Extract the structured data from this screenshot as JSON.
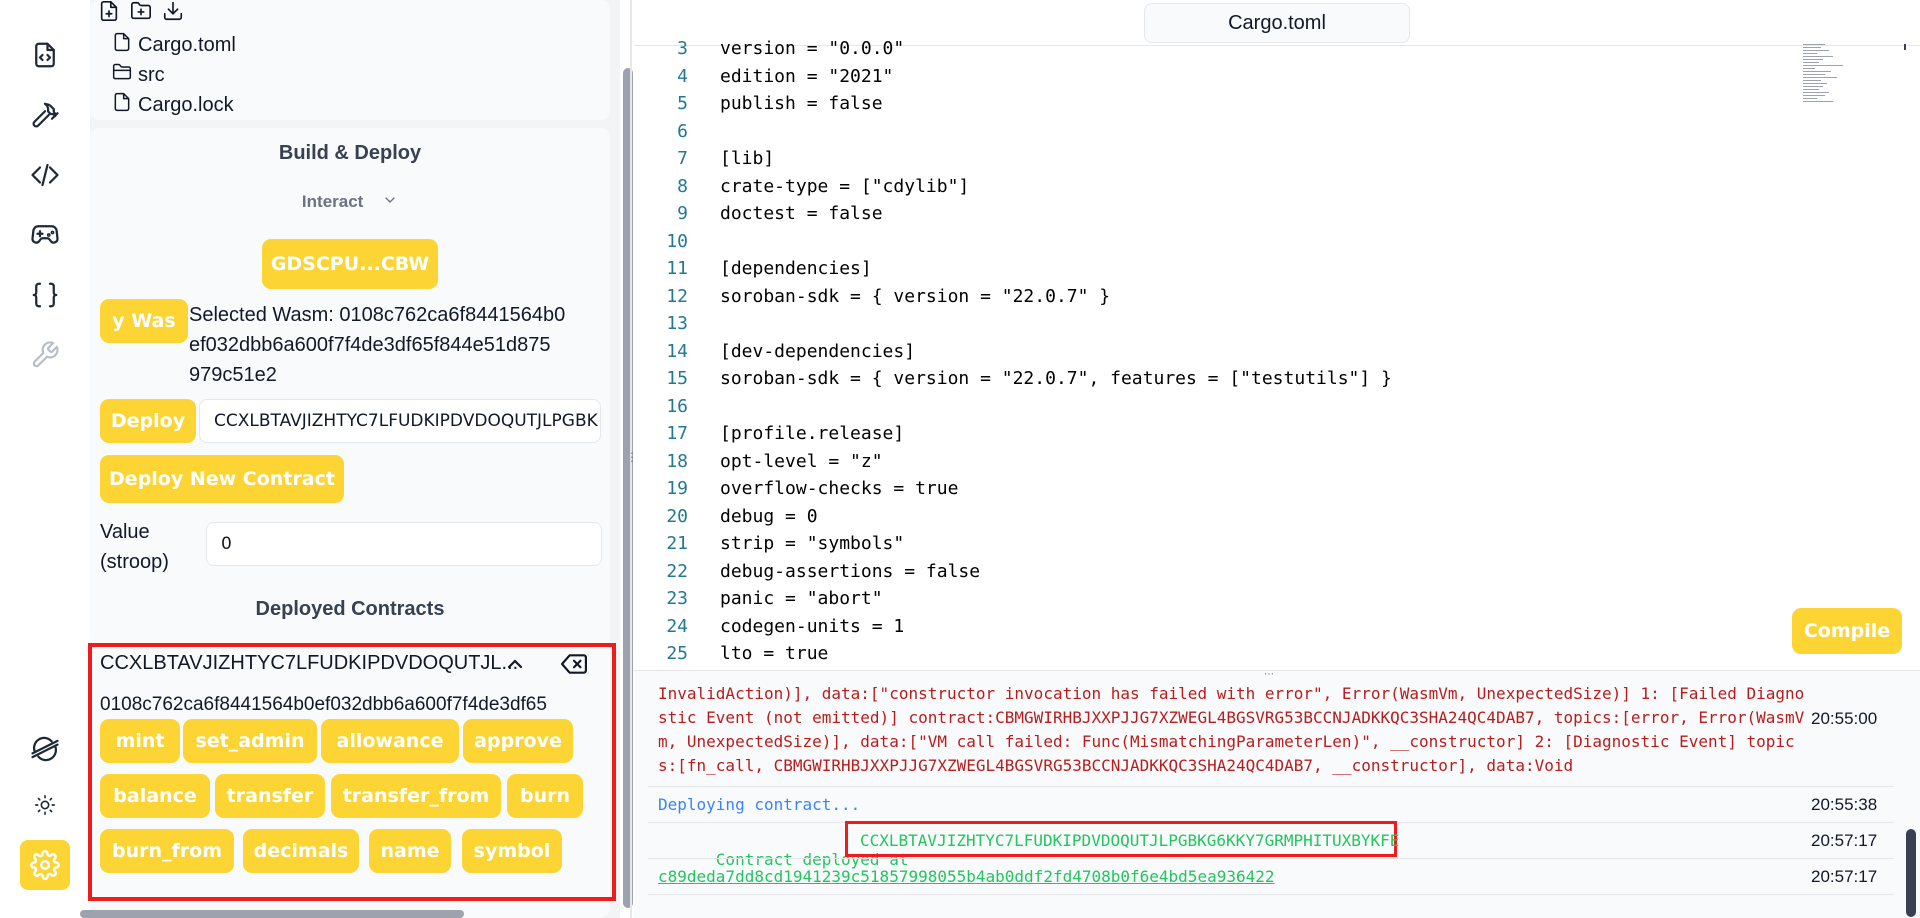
{
  "file_tree": {
    "items": [
      {
        "name": "Cargo.toml",
        "icon": "file-icon"
      },
      {
        "name": "src",
        "icon": "folder-icon"
      },
      {
        "name": "Cargo.lock",
        "icon": "file-icon"
      }
    ]
  },
  "deploy_panel": {
    "title": "Build & Deploy",
    "mode": "Interact",
    "account_button": "GDSCPU...CBW",
    "wasm_button": "y Was",
    "selected_wasm_line1": "Selected Wasm: 0108c762ca6f8441564b0",
    "selected_wasm_line2": "ef032dbb6a600f7f4de3df65f844e51d875",
    "selected_wasm_line3": "979c51e2",
    "deploy_button": "Deploy",
    "deploy_input_value": "CCXLBTAVJIZHTYC7LFUDKIPDVDOQUTJLPGBK",
    "deploy_new_button": "Deploy New Contract",
    "value_label_1": "Value",
    "value_label_2": "(stroop)",
    "value_input": "0",
    "deployed_title": "Deployed Contracts",
    "contract_id": "CCXLBTAVJIZHTYC7LFUDKIPDVDOQUTJL...",
    "contract_hash": "0108c762ca6f8441564b0ef032dbb6a600f7f4de3df65",
    "functions": [
      "mint",
      "set_admin",
      "allowance",
      "approve",
      "balance",
      "transfer",
      "transfer_from",
      "burn",
      "burn_from",
      "decimals",
      "name",
      "symbol"
    ]
  },
  "editor": {
    "tab": "Cargo.toml",
    "lines": [
      {
        "n": "3",
        "t": "version = \"0.0.0\""
      },
      {
        "n": "4",
        "t": "edition = \"2021\""
      },
      {
        "n": "5",
        "t": "publish = false"
      },
      {
        "n": "6",
        "t": ""
      },
      {
        "n": "7",
        "t": "[lib]"
      },
      {
        "n": "8",
        "t": "crate-type = [\"cdylib\"]"
      },
      {
        "n": "9",
        "t": "doctest = false"
      },
      {
        "n": "10",
        "t": ""
      },
      {
        "n": "11",
        "t": "[dependencies]"
      },
      {
        "n": "12",
        "t": "soroban-sdk = { version = \"22.0.7\" }"
      },
      {
        "n": "13",
        "t": ""
      },
      {
        "n": "14",
        "t": "[dev-dependencies]"
      },
      {
        "n": "15",
        "t": "soroban-sdk = { version = \"22.0.7\", features = [\"testutils\"] }"
      },
      {
        "n": "16",
        "t": ""
      },
      {
        "n": "17",
        "t": "[profile.release]"
      },
      {
        "n": "18",
        "t": "opt-level = \"z\""
      },
      {
        "n": "19",
        "t": "overflow-checks = true"
      },
      {
        "n": "20",
        "t": "debug = 0"
      },
      {
        "n": "21",
        "t": "strip = \"symbols\""
      },
      {
        "n": "22",
        "t": "debug-assertions = false"
      },
      {
        "n": "23",
        "t": "panic = \"abort\""
      },
      {
        "n": "24",
        "t": "codegen-units = 1"
      },
      {
        "n": "25",
        "t": "lto = true"
      }
    ],
    "compile_button": "Compile"
  },
  "terminal": {
    "error_lines": [
      "InvalidAction)], data:[\"constructor invocation has failed with error\", Error(WasmVm, UnexpectedSize)] 1: [Failed Diagno",
      "stic Event (not emitted)] contract:CBMGWIRHBJXXPJJG7XZWEGL4BGSVRG53BCCNJADKKQC3SHA24QC4DAB7, topics:[error, Error(WasmV",
      "m, UnexpectedSize)], data:[\"VM call failed: Func(MismatchingParameterLen)\", __constructor] 2: [Diagnostic Event] topic",
      "s:[fn_call, CBMGWIRHBJXXPJJG7XZWEGL4BGSVRG53BCCNJADKKQC3SHA24QC4DAB7, __constructor], data:Void"
    ],
    "error_time": "20:55:00",
    "deploying_text": "Deploying contract...",
    "deploying_time": "20:55:38",
    "deployed_prefix": "Contract deployed at",
    "deployed_address": "CCXLBTAVJIZHTYC7LFUDKIPDVDOQUTJLPGBKG6KKY7GRMPHITUXBYKFE",
    "deployed_time": "20:57:17",
    "tx_hash": "c89deda7dd8cd1941239c51857998055b4ab0ddf2fd4708b0f6e4bd5ea936422",
    "tx_time": "20:57:17"
  },
  "colors": {
    "accent": "#fcd535",
    "highlight": "#ef1c1c",
    "error": "#b91c1c",
    "info": "#3b82f6",
    "success": "#22c55e"
  }
}
